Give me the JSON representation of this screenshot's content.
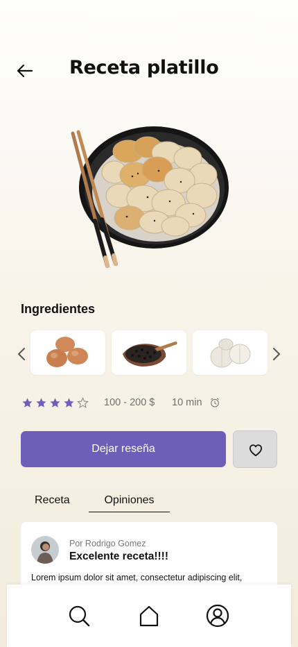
{
  "header": {
    "title": "Receta platillo",
    "back_icon": "arrow-left-icon"
  },
  "hero": {
    "image": "dumplings-plate-with-chopsticks"
  },
  "ingredients": {
    "title": "Ingredientes",
    "items": [
      {
        "name": "eggs",
        "icon": "eggs-image"
      },
      {
        "name": "black-peppercorns",
        "icon": "pepper-image"
      },
      {
        "name": "garlic",
        "icon": "garlic-image"
      }
    ],
    "prev_icon": "chevron-left-icon",
    "next_icon": "chevron-right-icon"
  },
  "meta": {
    "rating": 4,
    "rating_max": 5,
    "price": "100 - 200 $",
    "time": "10 min",
    "time_icon": "alarm-clock-icon",
    "star_color": "#6d5eba"
  },
  "actions": {
    "review_label": "Dejar reseña",
    "favorite_icon": "heart-icon",
    "accent": "#6d5eba"
  },
  "tabs": [
    {
      "label": "Receta",
      "active": false
    },
    {
      "label": "Opiniones",
      "active": true
    }
  ],
  "review": {
    "author": "Por Rodrigo Gomez",
    "title": "Excelente receta!!!!",
    "body": "Lorem ipsum dolor sit amet, consectetur adipiscing elit,"
  },
  "bottom_nav": [
    {
      "name": "search",
      "icon": "search-icon"
    },
    {
      "name": "home",
      "icon": "home-icon"
    },
    {
      "name": "profile",
      "icon": "user-circle-icon"
    }
  ]
}
